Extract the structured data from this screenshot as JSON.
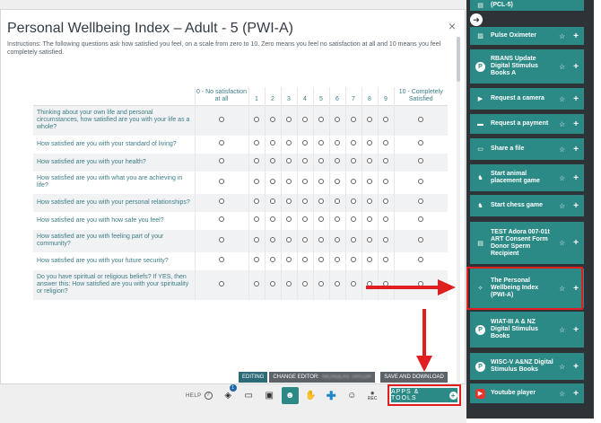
{
  "modal": {
    "title": "Personal Wellbeing Index – Adult - 5 (PWI-A)",
    "close": "×",
    "instructions": "Instructions: The following questions ask how satisfied you feel, on a scale from zero to 10. Zero means you feel no satisfaction at all and 10 means you feel completely satisfied."
  },
  "table": {
    "columns": [
      "0 - No satisfaction at all",
      "1",
      "2",
      "3",
      "4",
      "5",
      "6",
      "7",
      "8",
      "9",
      "10 - Completely Satisfied"
    ],
    "questions": [
      "Thinking about your own life and personal circumstances, how satisfied are you with your life as a whole?",
      "How satisfied are you with your standard of living?",
      "How satisfied are you with your health?",
      "How satisfied are you with what you are achieving in life?",
      "How satisfied are you with your personal relationships?",
      "How satisfied are you with how safe you feel?",
      "How satisfied are you with feeling part of your community?",
      "How satisfied are you with your future security?",
      "Do you have spiritual or religious beliefs? If YES, then answer this: How satisfied are you with your spirituality or religion?"
    ]
  },
  "edit_bar": {
    "editing": "EDITING",
    "change_editor": "CHANGE EDITOR:",
    "editor_value": "NICHOLAS TAYLOR",
    "save_download": "SAVE AND DOWNLOAD"
  },
  "toolbar": {
    "help": "HELP",
    "help_icon": "?",
    "badge": "1",
    "rec": "REC",
    "apps_tools": "APPS & TOOLS"
  },
  "sidebar": {
    "items": [
      {
        "label": "(PCL-5)",
        "icon": "doc-icon"
      },
      {
        "label": "Pulse Oximeter",
        "icon": "image-icon"
      },
      {
        "label": "RBANS Update Digital Stimulus Books A",
        "icon": "p-logo-icon"
      },
      {
        "label": "Request a camera",
        "icon": "camera-icon"
      },
      {
        "label": "Request a payment",
        "icon": "payment-icon"
      },
      {
        "label": "Share a file",
        "icon": "folder-icon"
      },
      {
        "label": "Start animal placement game",
        "icon": "game-icon"
      },
      {
        "label": "Start chess game",
        "icon": "game-icon"
      },
      {
        "label": "TEST Adora 007-01t ART Consent Form Donor Sperm Recipient",
        "icon": "doc-icon"
      },
      {
        "label": "The Personal Wellbeing Index (PWI-A)",
        "icon": "wellbeing-icon"
      },
      {
        "label": "WIAT-III A & NZ Digital Stimulus Books",
        "icon": "p-logo-icon"
      },
      {
        "label": "WISC-V A&NZ Digital Stimulus Books",
        "icon": "p-logo-icon"
      },
      {
        "label": "Youtube player",
        "icon": "youtube-icon"
      }
    ]
  },
  "colors": {
    "accent": "#2b8a86",
    "sidebar_bg": "#2e3338",
    "annotation_red": "#e02020"
  }
}
